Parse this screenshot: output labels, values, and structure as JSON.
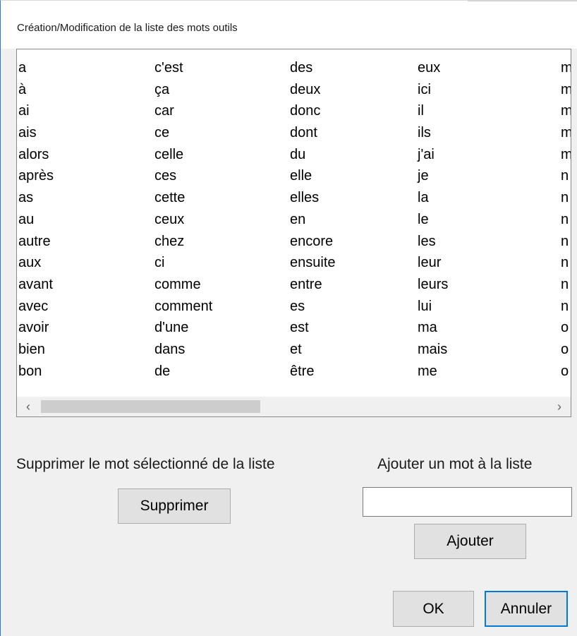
{
  "window": {
    "title": "Création/Modification de la liste des mots outils"
  },
  "list": {
    "columns": [
      [
        "a",
        "à",
        "ai",
        "ais",
        "alors",
        "après",
        "as",
        "au",
        "autre",
        "aux",
        "avant",
        "avec",
        "avoir",
        "bien",
        "bon"
      ],
      [
        "c'est",
        "ça",
        "car",
        "ce",
        "celle",
        "ces",
        "cette",
        "ceux",
        "chez",
        "ci",
        "comme",
        "comment",
        "d'une",
        "dans",
        "de"
      ],
      [
        "des",
        "deux",
        "donc",
        "dont",
        "du",
        "elle",
        "elles",
        "en",
        "encore",
        "ensuite",
        "entre",
        "es",
        "est",
        "et",
        "être"
      ],
      [
        "eux",
        "ici",
        "il",
        "ils",
        "j'ai",
        "je",
        "la",
        "le",
        "les",
        "leur",
        "leurs",
        "lui",
        "ma",
        "mais",
        "me"
      ],
      [
        "m",
        "m",
        "m",
        "m",
        "m",
        "n",
        "n",
        "n",
        "n",
        "n",
        "n",
        "n",
        "o",
        "o",
        "o"
      ]
    ],
    "scroll_left_arrow": "‹",
    "scroll_right_arrow": "›"
  },
  "delete_section": {
    "label": "Supprimer le mot sélectionné de la liste",
    "button": "Supprimer"
  },
  "add_section": {
    "label": "Ajouter un mot à la liste",
    "input_value": "",
    "button": "Ajouter"
  },
  "footer": {
    "ok": "OK",
    "cancel": "Annuler"
  },
  "colors": {
    "accent": "#0078d7",
    "button_bg": "#e1e1e1",
    "dialog_bg": "#f0f0f0"
  }
}
